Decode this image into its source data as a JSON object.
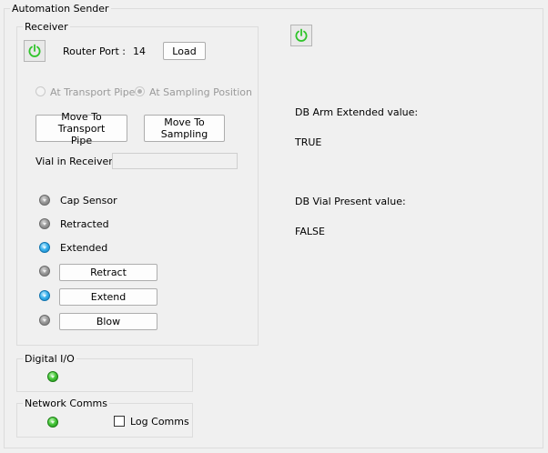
{
  "automation_sender": {
    "title": "Automation Sender",
    "receiver": {
      "title": "Receiver",
      "power_icon": "power-icon",
      "router_port_label": "Router Port :",
      "router_port_value": "14",
      "load_label": "Load",
      "radio_transport": "At Transport Pipe",
      "radio_sampling": "At Sampling Position",
      "move_transport_label": "Move To Transport Pipe",
      "move_sampling_label": "Move To Sampling",
      "vial_label": "Vial in Receiver",
      "vial_value": "",
      "cap_sensor_label": "Cap Sensor",
      "retracted_label": "Retracted",
      "extended_label": "Extended",
      "retract_label": "Retract",
      "extend_label": "Extend",
      "blow_label": "Blow",
      "led_colors": {
        "gray": "#9c9c9c",
        "blue": "#3bb3ee",
        "green": "#48c93b"
      }
    },
    "digital_io": {
      "title": "Digital I/O"
    },
    "network_comms": {
      "title": "Network Comms",
      "log_comms_label": "Log Comms"
    },
    "db": {
      "arm_extended_label": "DB Arm Extended value:",
      "arm_extended_value": "TRUE",
      "vial_present_label": "DB Vial Present value:",
      "vial_present_value": "FALSE"
    }
  }
}
